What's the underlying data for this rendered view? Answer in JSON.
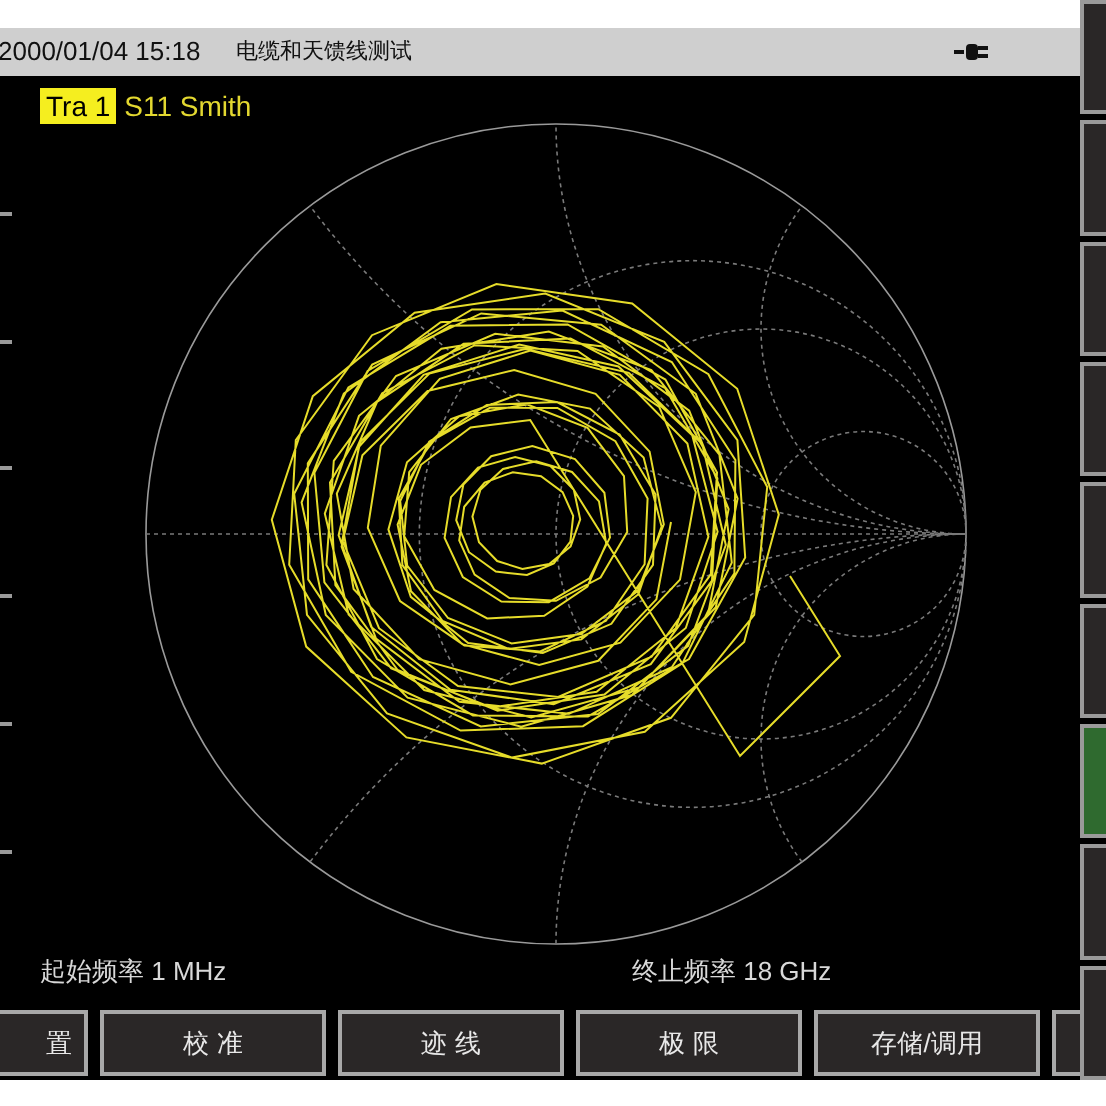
{
  "status_bar": {
    "datetime": "2000/01/04 15:18",
    "title": "电缆和天馈线测试"
  },
  "trace": {
    "badge": "Tra 1",
    "label": "S11 Smith"
  },
  "start_frequency": "起始频率 1 MHz",
  "stop_frequency": "终止频率 18 GHz",
  "softkeys": [
    {
      "selected": false
    },
    {
      "selected": false
    },
    {
      "selected": false
    },
    {
      "selected": false
    },
    {
      "selected": false
    },
    {
      "selected": false
    },
    {
      "selected": true
    },
    {
      "selected": false
    },
    {
      "selected": false
    }
  ],
  "menu_buttons": [
    {
      "label": "置"
    },
    {
      "label": "校 准"
    },
    {
      "label": "迹 线"
    },
    {
      "label": "极 限"
    },
    {
      "label": "存储/调用"
    }
  ]
}
